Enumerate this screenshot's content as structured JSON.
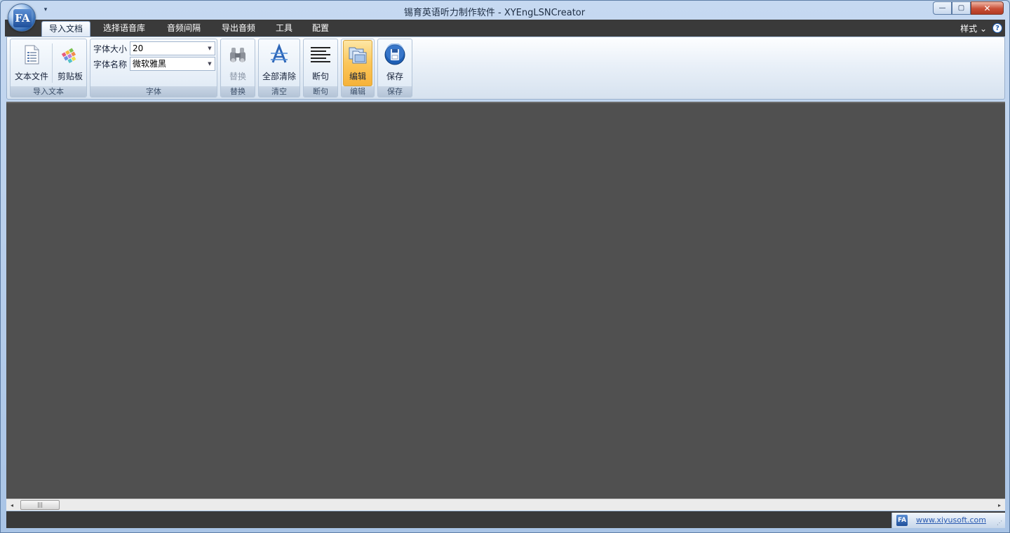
{
  "window": {
    "title": "锡育英语听力制作软件 - XYEngLSNCreator",
    "app_logo": "FA",
    "qat_icon": "▾",
    "controls": {
      "minimize": "—",
      "maximize": "▢",
      "close": "✕"
    }
  },
  "tabs": [
    {
      "label": "导入文档",
      "active": true
    },
    {
      "label": "选择语音库",
      "active": false
    },
    {
      "label": "音频间隔",
      "active": false
    },
    {
      "label": "导出音频",
      "active": false
    },
    {
      "label": "工具",
      "active": false
    },
    {
      "label": "配置",
      "active": false
    }
  ],
  "style_menu": {
    "label": "样式",
    "arrow": "⌄"
  },
  "help": {
    "icon": "?"
  },
  "ribbon": {
    "import_group": {
      "label": "导入文本",
      "text_file": "文本文件",
      "clipboard": "剪贴板"
    },
    "font_group": {
      "label": "字体",
      "size_label": "字体大小",
      "size_value": "20",
      "name_label": "字体名称",
      "name_value": "微软雅黑",
      "arrow": "▼"
    },
    "replace_group": {
      "label": "替换",
      "button": "替换"
    },
    "clear_group": {
      "label": "清空",
      "button": "全部清除"
    },
    "split_group": {
      "label": "断句",
      "button": "断句"
    },
    "edit_group": {
      "label": "编辑",
      "button": "编辑"
    },
    "save_group": {
      "label": "保存",
      "button": "保存"
    }
  },
  "scrollbar": {
    "left": "◂",
    "right": "▸",
    "grip": "|||"
  },
  "status": {
    "logo": "FA",
    "link": "www.xiyusoft.com",
    "grip": "⋰"
  },
  "colors": {
    "content_bg": "#505050",
    "tab_strip": "#3a3a3a",
    "edit_active": "#fbc65a"
  }
}
